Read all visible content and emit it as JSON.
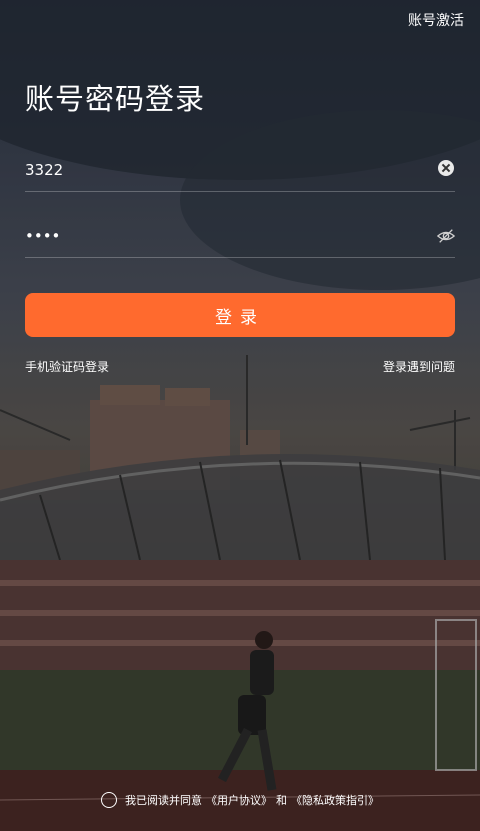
{
  "header": {
    "action_label": "账号激活"
  },
  "page_title": "账号密码登录",
  "account_field": {
    "value": "3322"
  },
  "password_field": {
    "value": "••••"
  },
  "login_button": {
    "label": "登录"
  },
  "links": {
    "sms_login": "手机验证码登录",
    "help": "登录遇到问题"
  },
  "agreement": {
    "prefix": "我已阅读并同意",
    "user_agreement": "《用户协议》",
    "conjunction": "和",
    "privacy_policy": "《隐私政策指引》"
  },
  "colors": {
    "accent": "#ff6a2e"
  }
}
